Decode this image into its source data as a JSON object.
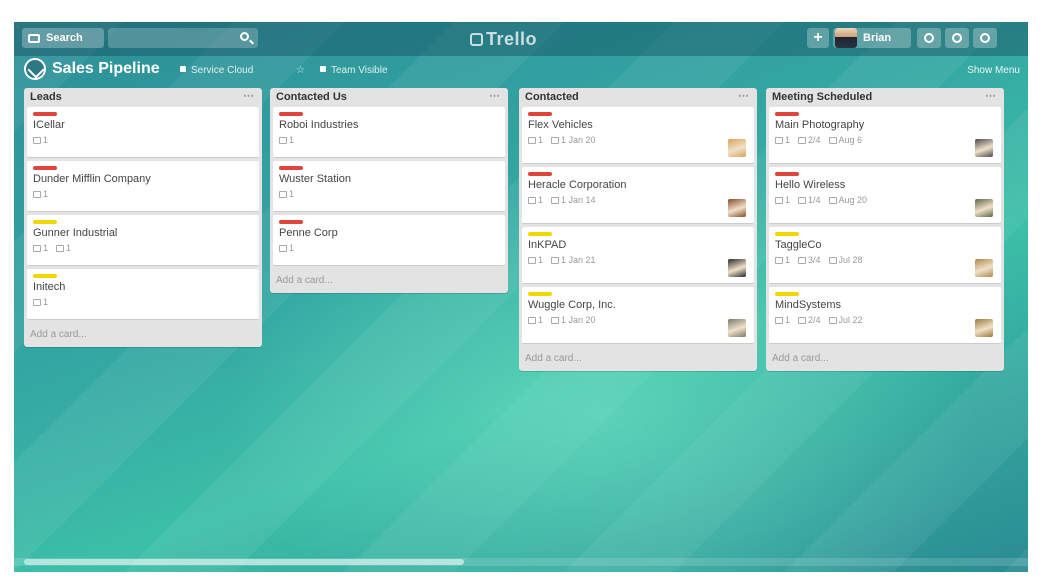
{
  "header": {
    "search_label": "Search",
    "search_value": "",
    "logo_text": "Trello",
    "add_label": "+",
    "user_name": "Brian"
  },
  "board": {
    "title": "Sales Pipeline",
    "team_label": "Service Cloud",
    "visibility_label": "Team Visible",
    "show_menu_label": "Show Menu"
  },
  "lists": [
    {
      "title": "Leads",
      "add_label": "Add a card...",
      "cards": [
        {
          "label": "red",
          "title": "ICellar",
          "badges": [
            "1"
          ]
        },
        {
          "label": "red",
          "title": "Dunder Mifflin Company",
          "badges": [
            "1"
          ]
        },
        {
          "label": "yellow",
          "title": "Gunner Industrial",
          "badges": [
            "1",
            "1"
          ]
        },
        {
          "label": "yellow",
          "title": "Initech",
          "badges": [
            "1"
          ]
        }
      ]
    },
    {
      "title": "Contacted Us",
      "add_label": "Add a card...",
      "cards": [
        {
          "label": "red",
          "title": "Roboi Industries",
          "badges": [
            "1"
          ]
        },
        {
          "label": "red",
          "title": "Wuster Station",
          "badges": [
            "1"
          ]
        },
        {
          "label": "red",
          "title": "Penne Corp",
          "badges": [
            "1"
          ]
        }
      ]
    },
    {
      "title": "Contacted",
      "add_label": "Add a card...",
      "cards": [
        {
          "label": "red",
          "title": "Flex Vehicles",
          "badges": [
            "1",
            "1 Jan 20"
          ],
          "member": "#d9a45a"
        },
        {
          "label": "red",
          "title": "Heracle Corporation",
          "badges": [
            "1",
            "1 Jan 14"
          ],
          "member": "#8a4b2a"
        },
        {
          "label": "yellow",
          "title": "InKPAD",
          "badges": [
            "1",
            "1 Jan 21"
          ],
          "member": "#2a2a2a"
        },
        {
          "label": "yellow",
          "title": "Wuggle Corp, Inc.",
          "badges": [
            "1",
            "1 Jan 20"
          ],
          "member": "#7a7a6a"
        }
      ]
    },
    {
      "title": "Meeting Scheduled",
      "add_label": "Add a card...",
      "cards": [
        {
          "label": "red",
          "title": "Main Photography",
          "badges": [
            "1",
            "2/4",
            "Aug 6"
          ],
          "member": "#4a4a4a"
        },
        {
          "label": "red",
          "title": "Hello Wireless",
          "badges": [
            "1",
            "1/4",
            "Aug 20"
          ],
          "member": "#5a6a4a"
        },
        {
          "label": "yellow",
          "title": "TaggleCo",
          "badges": [
            "1",
            "3/4",
            "Jul 28"
          ],
          "member": "#b0894f"
        },
        {
          "label": "yellow",
          "title": "MindSystems",
          "badges": [
            "1",
            "2/4",
            "Jul 22"
          ],
          "member": "#9a7a3a"
        }
      ]
    }
  ]
}
